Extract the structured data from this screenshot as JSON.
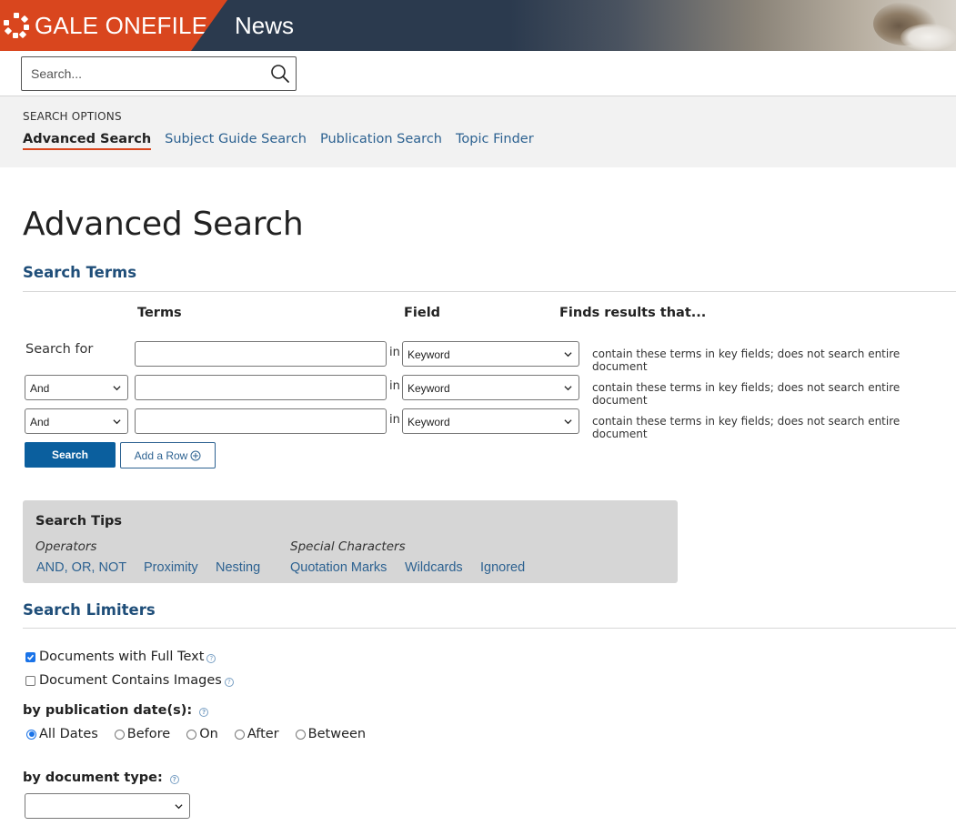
{
  "brand": {
    "logo": "GALE ONEFILE",
    "product": "News",
    "accent": "#d9461e",
    "link_color": "#2d6291",
    "heading_color": "#1f4e79"
  },
  "topsearch": {
    "placeholder": "Search...",
    "icon": "search-icon"
  },
  "search_options": {
    "label": "SEARCH OPTIONS",
    "tabs": [
      "Advanced Search",
      "Subject Guide Search",
      "Publication Search",
      "Topic Finder"
    ],
    "active": "Advanced Search"
  },
  "page": {
    "title": "Advanced Search"
  },
  "search_terms": {
    "heading": "Search Terms",
    "col_terms": "Terms",
    "col_field": "Field",
    "col_finds": "Finds results that...",
    "search_for": "Search for",
    "in_label": "in",
    "rows": [
      {
        "operator": "",
        "term": "",
        "field": "Keyword",
        "finds": "contain these terms in key fields; does not search entire document"
      },
      {
        "operator": "And",
        "term": "",
        "field": "Keyword",
        "finds": "contain these terms in key fields; does not search entire document"
      },
      {
        "operator": "And",
        "term": "",
        "field": "Keyword",
        "finds": "contain these terms in key fields; does not search entire document"
      }
    ],
    "search_button": "Search",
    "add_row_button": "Add a Row"
  },
  "search_tips": {
    "heading": "Search Tips",
    "operators_label": "Operators",
    "operators": [
      "AND, OR, NOT",
      "Proximity",
      "Nesting"
    ],
    "special_label": "Special Characters",
    "special": [
      "Quotation Marks",
      "Wildcards",
      "Ignored"
    ]
  },
  "search_limiters": {
    "heading": "Search Limiters",
    "full_text": {
      "label": "Documents with Full Text",
      "checked": true
    },
    "images": {
      "label": "Document Contains Images",
      "checked": false
    },
    "pub_date_label": "by publication date(s):",
    "date_options": [
      "All Dates",
      "Before",
      "On",
      "After",
      "Between"
    ],
    "date_selected": "All Dates",
    "doc_type_label": "by document type:",
    "doc_type_value": ""
  }
}
